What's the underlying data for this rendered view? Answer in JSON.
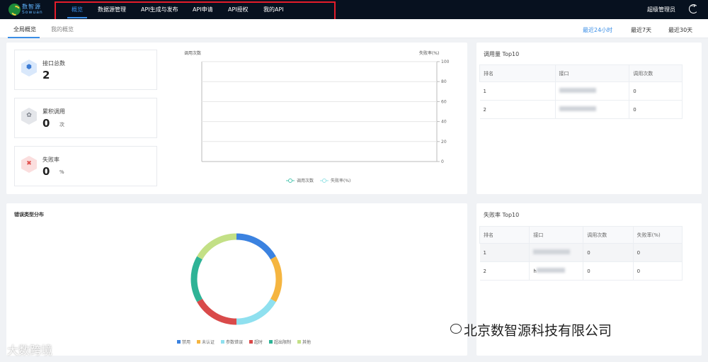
{
  "header": {
    "logo_cn": "数智源",
    "logo_en": "Sowuan",
    "nav": [
      "概览",
      "数据源管理",
      "API生成与发布",
      "API申请",
      "API授权",
      "我的API"
    ],
    "active_nav": 0,
    "user": "超级管理员"
  },
  "subnav": {
    "tabs": [
      "全局概览",
      "我的概览"
    ],
    "ranges": [
      "最近24小时",
      "最近7天",
      "最近30天"
    ],
    "active_range": 0
  },
  "stats": [
    {
      "label": "接口总数",
      "value": "2",
      "unit": "",
      "icon": "api-hex-icon"
    },
    {
      "label": "累积调用",
      "value": "0",
      "unit": "次",
      "icon": "calls-hex-icon"
    },
    {
      "label": "失败率",
      "value": "0",
      "unit": "%",
      "icon": "fail-hex-icon"
    }
  ],
  "chart_data": [
    {
      "type": "line",
      "ylabel": "调用次数",
      "y2label": "失败率(%)",
      "y2lim": [
        0,
        100
      ],
      "y2ticks": [
        0,
        20,
        40,
        60,
        80,
        100
      ],
      "series": [
        {
          "name": "调用次数",
          "values": []
        },
        {
          "name": "失败率(%)",
          "values": []
        }
      ],
      "legend": "bottom",
      "colors": [
        "#4fc6b0",
        "#97e3e6"
      ]
    },
    {
      "type": "pie",
      "title": "错误类型分布",
      "categories": [
        "禁用",
        "未认证",
        "参数错误",
        "超时",
        "超出限制",
        "其他"
      ],
      "values": [
        1,
        1,
        1,
        1,
        1,
        1
      ],
      "colors": [
        "#3b82e0",
        "#f5b540",
        "#8fe0ef",
        "#d94a4a",
        "#2eb396",
        "#c3e086"
      ],
      "legend": "bottom"
    }
  ],
  "top_calls": {
    "title": "调用量 Top10",
    "columns": [
      "排名",
      "接口",
      "调用次数"
    ],
    "rows": [
      [
        "1",
        "",
        "0"
      ],
      [
        "2",
        "",
        "0"
      ]
    ]
  },
  "top_fail": {
    "title": "失败率 Top10",
    "columns": [
      "排名",
      "接口",
      "调用次数",
      "失败率(%)"
    ],
    "rows": [
      [
        "1",
        "",
        "0",
        "0"
      ],
      [
        "2",
        "h",
        "0",
        "0"
      ]
    ]
  },
  "watermarks": {
    "left": "大数跨境",
    "right": "北京数智源科技有限公司"
  }
}
